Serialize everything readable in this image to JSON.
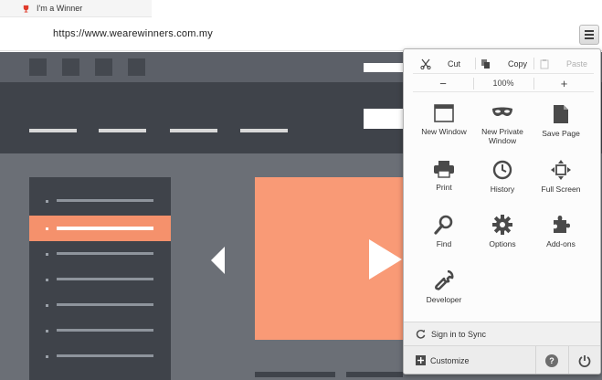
{
  "tab": {
    "title": "I'm a Winner",
    "favicon_icon": "trophy-icon",
    "favicon_color": "#e03b2b"
  },
  "address_bar": {
    "url": "https://www.wearewinners.com.my"
  },
  "toolbar": {
    "menu_icon": "hamburger-menu-icon"
  },
  "menu_panel": {
    "edit": [
      {
        "label": "Cut",
        "icon": "scissors-icon",
        "enabled": true
      },
      {
        "label": "Copy",
        "icon": "copy-icon",
        "enabled": true
      },
      {
        "label": "Paste",
        "icon": "paste-icon",
        "enabled": false
      }
    ],
    "zoom": {
      "out_label": "−",
      "level": "100%",
      "in_label": "+"
    },
    "items": [
      {
        "label_line1": "New Window",
        "label_line2": "",
        "icon": "new-window-icon"
      },
      {
        "label_line1": "New Private",
        "label_line2": "Window",
        "icon": "private-mask-icon"
      },
      {
        "label_line1": "Save Page",
        "label_line2": "",
        "icon": "page-icon"
      },
      {
        "label_line1": "Print",
        "label_line2": "",
        "icon": "printer-icon"
      },
      {
        "label_line1": "History",
        "label_line2": "",
        "icon": "clock-icon"
      },
      {
        "label_line1": "Full Screen",
        "label_line2": "",
        "icon": "fullscreen-arrows-icon"
      },
      {
        "label_line1": "Find",
        "label_line2": "",
        "icon": "magnifier-icon"
      },
      {
        "label_line1": "Options",
        "label_line2": "",
        "icon": "gear-icon"
      },
      {
        "label_line1": "Add-ons",
        "label_line2": "",
        "icon": "puzzle-icon"
      },
      {
        "label_line1": "Developer",
        "label_line2": "",
        "icon": "wrench-icon"
      }
    ],
    "sync_label": "Sign in to Sync",
    "customize_label": "Customize",
    "help_icon": "help-icon",
    "help_glyph": "?",
    "quit_icon": "power-icon"
  },
  "colors": {
    "accent": "#f5916c",
    "page_bg": "#6b6f76",
    "dark_band": "#3f434a",
    "icon_color": "#4a4a4a"
  }
}
